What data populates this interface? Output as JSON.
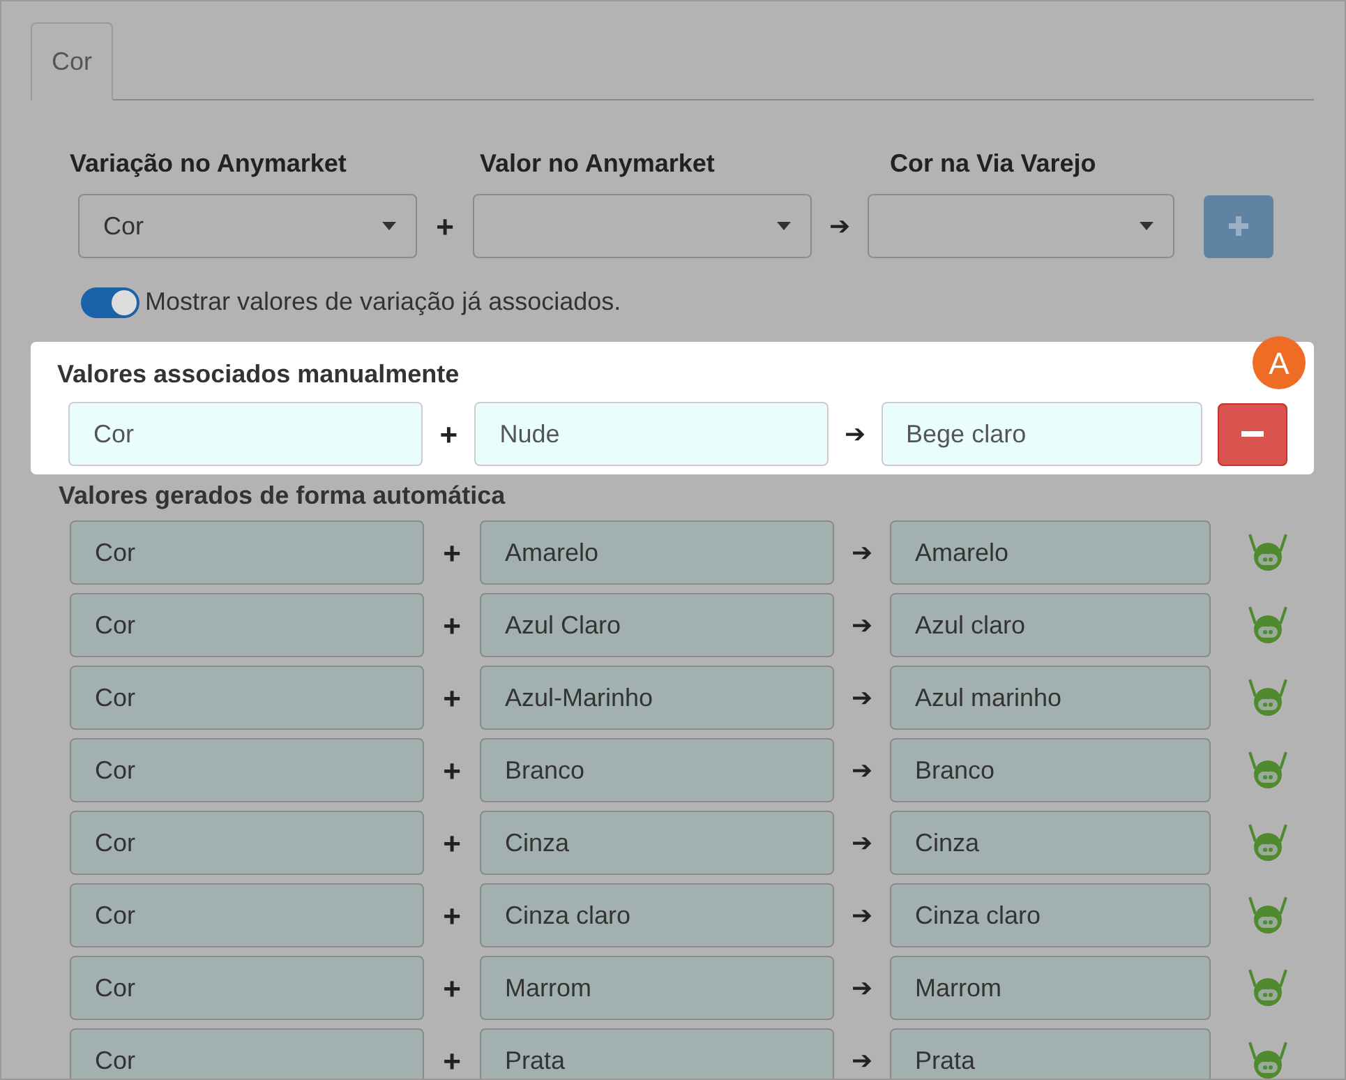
{
  "tabs": [
    {
      "label": "Cor",
      "selected": true
    }
  ],
  "form": {
    "columns": [
      {
        "label": "Variação no Anymarket",
        "value": "Cor"
      },
      {
        "label": "Valor no Anymarket"
      },
      {
        "label": "Cor na Via Varejo"
      }
    ],
    "plus": "+",
    "arrow": "➔",
    "add_disabled": true
  },
  "toggle": {
    "on": true,
    "label": "Mostrar valores de variação já associados."
  },
  "manual": {
    "title": "Valores associados manualmente",
    "badge": "A",
    "rows": [
      {
        "variation": "Cor",
        "value": "Nude",
        "target": "Bege claro"
      }
    ]
  },
  "automatic": {
    "title": "Valores gerados de forma automática",
    "rows": [
      {
        "variation": "Cor",
        "value": "Amarelo",
        "target": "Amarelo"
      },
      {
        "variation": "Cor",
        "value": "Azul Claro",
        "target": "Azul claro"
      },
      {
        "variation": "Cor",
        "value": "Azul-Marinho",
        "target": "Azul marinho"
      },
      {
        "variation": "Cor",
        "value": "Branco",
        "target": "Branco"
      },
      {
        "variation": "Cor",
        "value": "Cinza",
        "target": "Cinza"
      },
      {
        "variation": "Cor",
        "value": "Cinza claro",
        "target": "Cinza claro"
      },
      {
        "variation": "Cor",
        "value": "Marrom",
        "target": "Marrom"
      },
      {
        "variation": "Cor",
        "value": "Prata",
        "target": "Prata"
      }
    ]
  }
}
